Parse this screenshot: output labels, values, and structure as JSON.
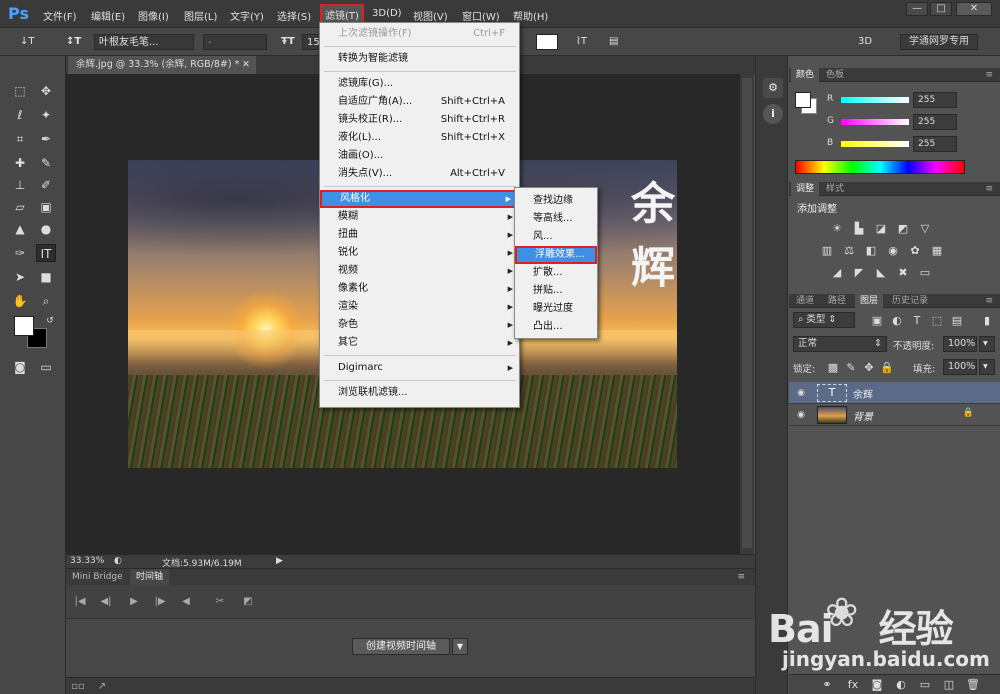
{
  "app": {
    "logo": "Ps"
  },
  "menubar": {
    "items": [
      "文件(F)",
      "编辑(E)",
      "图像(I)",
      "图层(L)",
      "文字(Y)",
      "选择(S)",
      "滤镜(T)",
      "3D(D)",
      "视图(V)",
      "窗口(W)",
      "帮助(H)"
    ],
    "window_buttons": [
      "—",
      "□",
      "✕"
    ]
  },
  "options_bar": {
    "tool_icon": "↓T",
    "font_family": "叶根友毛笔...",
    "font_style": "-",
    "font_size": "158",
    "label_3d": "3D",
    "workspace": "学通网罗专用"
  },
  "document": {
    "tab_title": "余辉.jpg @ 33.3% (余辉, RGB/8#) *",
    "calligraphy": "余辉"
  },
  "status": {
    "zoom": "33.33%",
    "doc_size": "文档:5.93M/6.19M"
  },
  "timeline": {
    "tabs": [
      "Mini Bridge",
      "时间轴"
    ],
    "create_button": "创建视频时间轴"
  },
  "color_panel": {
    "tabs": [
      "颜色",
      "色板"
    ],
    "channels": [
      {
        "label": "R",
        "value": "255",
        "gradient": "linear-gradient(90deg,#0ff,#fff)"
      },
      {
        "label": "G",
        "value": "255",
        "gradient": "linear-gradient(90deg,#f0f,#fff)"
      },
      {
        "label": "B",
        "value": "255",
        "gradient": "linear-gradient(90deg,#ff0,#fff)"
      }
    ]
  },
  "adjust_panel": {
    "tabs": [
      "调整",
      "样式"
    ],
    "title": "添加调整"
  },
  "layers_panel": {
    "tabs": [
      "通道",
      "路径",
      "图层",
      "历史记录"
    ],
    "filter_kind": "类型",
    "blend_mode": "正常",
    "opacity_label": "不透明度:",
    "opacity": "100%",
    "lock_label": "锁定:",
    "fill_label": "填充:",
    "fill": "100%",
    "layers": [
      {
        "name": "余辉",
        "type": "text",
        "selected": true
      },
      {
        "name": "背景",
        "type": "image",
        "selected": false
      }
    ]
  },
  "filter_menu": {
    "items": [
      {
        "label": "上次滤镜操作(F)",
        "shortcut": "Ctrl+F",
        "disabled": true
      },
      {
        "sep": true
      },
      {
        "label": "转换为智能滤镜"
      },
      {
        "sep": true
      },
      {
        "label": "滤镜库(G)..."
      },
      {
        "label": "自适应广角(A)...",
        "shortcut": "Shift+Ctrl+A"
      },
      {
        "label": "镜头校正(R)...",
        "shortcut": "Shift+Ctrl+R"
      },
      {
        "label": "液化(L)...",
        "shortcut": "Shift+Ctrl+X"
      },
      {
        "label": "油画(O)..."
      },
      {
        "label": "消失点(V)...",
        "shortcut": "Alt+Ctrl+V"
      },
      {
        "sep": true
      },
      {
        "label": "风格化",
        "submenu": true,
        "highlight": true
      },
      {
        "label": "模糊",
        "submenu": true
      },
      {
        "label": "扭曲",
        "submenu": true
      },
      {
        "label": "锐化",
        "submenu": true
      },
      {
        "label": "视频",
        "submenu": true
      },
      {
        "label": "像素化",
        "submenu": true
      },
      {
        "label": "渲染",
        "submenu": true
      },
      {
        "label": "杂色",
        "submenu": true
      },
      {
        "label": "其它",
        "submenu": true
      },
      {
        "sep": true
      },
      {
        "label": "Digimarc",
        "submenu": true
      },
      {
        "sep": true
      },
      {
        "label": "浏览联机滤镜..."
      }
    ]
  },
  "stylize_menu": {
    "items": [
      "查找边缘",
      "等高线...",
      "风...",
      "浮雕效果...",
      "扩散...",
      "拼贴...",
      "曝光过度",
      "凸出..."
    ],
    "highlight_index": 3
  },
  "watermark": {
    "logo_left": "Bai",
    "logo_right": "经验",
    "url": "jingyan.baidu.com"
  },
  "accent": "#3e8fe6",
  "highlight_border": "#e02020"
}
